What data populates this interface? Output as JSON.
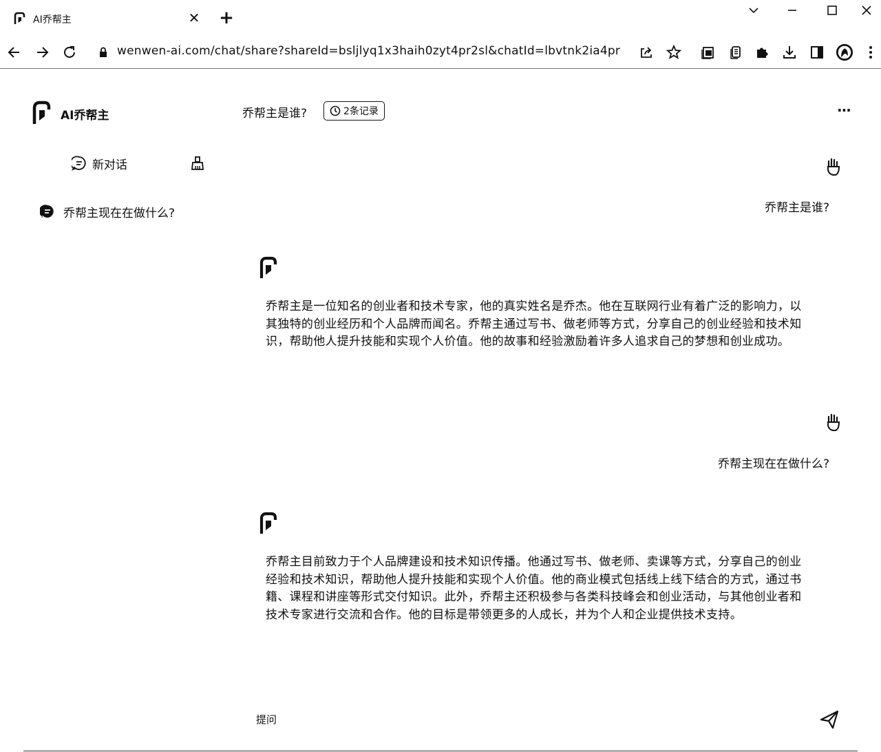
{
  "browser": {
    "tab_title": "AI乔帮主",
    "url": "wenwen-ai.com/chat/share?shareId=bsljlyq1x3haih0zyt4pr2sl&chatId=lbvtnk2ia4pr"
  },
  "sidebar": {
    "brand_name": "AI乔帮主",
    "new_chat_label": "新对话",
    "history": [
      {
        "label": "乔帮主现在在做什么?"
      }
    ]
  },
  "header": {
    "chat_title": "乔帮主是谁?",
    "records_label": "2条记录"
  },
  "messages": [
    {
      "role": "user",
      "text": "乔帮主是谁?"
    },
    {
      "role": "assistant",
      "text": "乔帮主是一位知名的创业者和技术专家，他的真实姓名是乔杰。他在互联网行业有着广泛的影响力，以其独特的创业经历和个人品牌而闻名。乔帮主通过写书、做老师等方式，分享自己的创业经验和技术知识，帮助他人提升技能和实现个人价值。他的故事和经验激励着许多人追求自己的梦想和创业成功。"
    },
    {
      "role": "user",
      "text": "乔帮主现在在做什么?"
    },
    {
      "role": "assistant",
      "text": "乔帮主目前致力于个人品牌建设和技术知识传播。他通过写书、做老师、卖课等方式，分享自己的创业经验和技术知识，帮助他人提升技能和实现个人价值。他的商业模式包括线上线下结合的方式，通过书籍、课程和讲座等形式交付知识。此外，乔帮主还积极参与各类科技峰会和创业活动，与其他创业者和技术专家进行交流和合作。他的目标是带领更多的人成长，并为个人和企业提供技术支持。"
    }
  ],
  "composer": {
    "placeholder": "提问"
  }
}
